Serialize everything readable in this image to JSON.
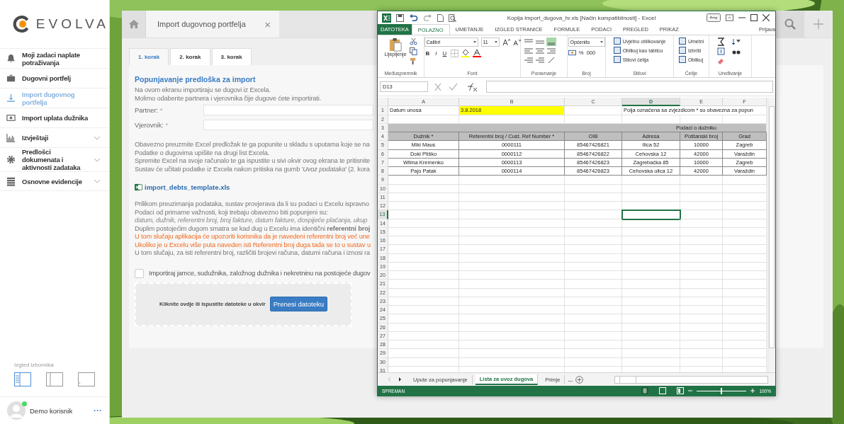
{
  "sidebar": {
    "logo": "EVOLVA",
    "items": [
      {
        "label": "Moji zadaci naplate potraživanja",
        "selected": false,
        "expandable": false
      },
      {
        "label": "Dugovni portfelj",
        "selected": false,
        "expandable": false
      },
      {
        "label": "Import dugovnog portfelja",
        "selected": true,
        "expandable": false
      },
      {
        "label": "Import uplata dužnika",
        "selected": false,
        "expandable": false
      },
      {
        "label": "Izvještaji",
        "selected": false,
        "expandable": true
      },
      {
        "label": "Predlošci dokumenata i aktivnosti zadataka",
        "selected": false,
        "expandable": true
      },
      {
        "label": "Osnovne evidencije",
        "selected": false,
        "expandable": true
      }
    ],
    "layout_label": "Izgled izbornika",
    "layouts": [
      {
        "selected": true
      },
      {
        "selected": false
      },
      {
        "selected": false
      }
    ],
    "user": {
      "name": "Demo korisnik",
      "online": true,
      "menu": "···"
    }
  },
  "tabs": [
    {
      "label": "Import dugovnog portfelja",
      "close": "×",
      "selected": true
    }
  ],
  "steps": [
    {
      "label": "1. korak",
      "selected": true
    },
    {
      "label": "2. korak",
      "selected": false
    },
    {
      "label": "3. korak",
      "selected": false
    }
  ],
  "form": {
    "title": "Popunjavanje predloška za import",
    "intro": [
      {
        "kind": "normal",
        "text": "Na ovom ekranu importiraju se dugovi iz Excela."
      },
      {
        "kind": "normal",
        "text": "Molimo odaberite partnera i vjerovnika čije dugove ćete importirati."
      }
    ],
    "fields": [
      {
        "label": "Partner:",
        "required": "*"
      },
      {
        "label": "Vjerovnik:",
        "required": "*"
      }
    ],
    "instructions": [
      {
        "kind": "normal",
        "text": "Obavezno preuzmite Excel predložak te ga popunite u skladu s uputama koje se na"
      },
      {
        "kind": "normal",
        "text": "Podatke o dugovima upišite na drugi list Excela."
      },
      {
        "kind": "normal",
        "text": "Spremite Excel na svoje računalo te ga ispustite u sivi okvir ovog ekrana te pritisnite"
      },
      {
        "kind": "normal",
        "text": "Sustav će učitati podatke iz Excela nakon pritiska na gumb '*Uvoz podataka*' (2. kora"
      }
    ],
    "template_link": "import_debts_template.xls",
    "checks": [
      {
        "kind": "normal",
        "text": "Prilikom preuzimanja podataka, sustav provjerava da li su podaci u Excelu ispravno"
      },
      {
        "kind": "normal",
        "text": "Podaci od primarne važnosti, koji trebaju obavezno biti popunjeni su:"
      },
      {
        "kind": "italic",
        "text": "datum, dužnik, referentni broj, broj fakture, datum fakture, dospijeće plaćanja, ukup"
      },
      {
        "kind": "normal",
        "text": "Duplim postojećim dugom smatra se kad dug u Excelu ima identični **referentni broj**"
      },
      {
        "kind": "warning",
        "text": "U tom slučaju aplikacija će upozoriti korisnika da je navedeni referentni broj već une"
      },
      {
        "kind": "warning",
        "text": "Ukoliko je u Excelu više puta naveden isti Referentni broj duga tada se to u sustav u"
      },
      {
        "kind": "normal",
        "text": "U tom slučaju, za isti referentni broj, različiti brojevi računa, datumi računa i iznosi ra"
      }
    ],
    "checkbox": {
      "label": "Importiraj jamce, sudužnika, založnog dužnika i nekretninu na postojeće dugov",
      "checked": false
    },
    "dropzone": {
      "hint": "Kliknite ovdje ili ispustite datoteke u okvir",
      "button": "Prenesi datoteku"
    }
  },
  "excel": {
    "title": "Kopija import_dugova_hr.xls  [Način kompatibilnosti] - Excel",
    "ribbon_tabs": [
      {
        "label": "DATOTEKA",
        "kind": "file",
        "selected": false
      },
      {
        "label": "POLAZNO",
        "kind": "tab",
        "selected": true
      },
      {
        "label": "UMETANJE",
        "kind": "tab",
        "selected": false
      },
      {
        "label": "IZGLED STRANICE",
        "kind": "tab",
        "selected": false
      },
      {
        "label": "FORMULE",
        "kind": "tab",
        "selected": false
      },
      {
        "label": "PODACI",
        "kind": "tab",
        "selected": false
      },
      {
        "label": "PREGLED",
        "kind": "tab",
        "selected": false
      },
      {
        "label": "PRIKAZ",
        "kind": "tab",
        "selected": false
      }
    ],
    "account": "Prijava",
    "ribbon": {
      "paste": "Lijepljenje",
      "font": "Calibri",
      "size": "11",
      "bold": "B",
      "italic": "I",
      "underline": "U",
      "number_format": "Općenito",
      "percent": "%",
      "thousands": "000",
      "styles": [
        "Uvjetno oblikovanje",
        "Oblikuj kao tablicu",
        "Stilovi ćelija"
      ],
      "cells": [
        "Umetni",
        "Izbriši",
        "Oblikuj"
      ],
      "groups": [
        "Međuspremnik",
        "Font",
        "Poravnanje",
        "Broj",
        "Stilovi",
        "Ćelije",
        "Uređivanje"
      ]
    },
    "name_box": "D13",
    "columns": [
      {
        "label": "A",
        "selected": false
      },
      {
        "label": "B",
        "selected": false
      },
      {
        "label": "C",
        "selected": false
      },
      {
        "label": "D",
        "selected": true
      },
      {
        "label": "E",
        "selected": false
      },
      {
        "label": "F",
        "selected": false
      }
    ],
    "rows": [
      {
        "number": "1",
        "kind": "data",
        "selected": false,
        "cells": {
          "A": {
            "text": "Datum unosa",
            "highlighted": false
          },
          "B": {
            "text": "3.8.2018",
            "highlighted": true
          },
          "D": {
            "text": "Polja označena sa zvjezdicom * su obavezna za popun",
            "highlighted": false
          }
        }
      },
      {
        "number": "2",
        "kind": "data"
      },
      {
        "number": "3",
        "kind": "group",
        "label": "Podaci o dužniku"
      },
      {
        "number": "4",
        "kind": "header",
        "A": "Dužnik *",
        "B": "Referentni broj / Cust. Ref Number *",
        "C": "OIB",
        "D": "Adresa",
        "E": "Poštanski broj",
        "F": "Grad"
      },
      {
        "number": "5",
        "kind": "record",
        "A": "Miki Maus",
        "B": "0000111",
        "C": "85467426821",
        "D": "Ilica 52",
        "E": "10000",
        "F": "Zagreb"
      },
      {
        "number": "6",
        "kind": "record",
        "A": "Doki Pliško",
        "B": "0000112",
        "C": "85467426822",
        "D": "Cehovska 12",
        "E": "42000",
        "F": "Varaždin"
      },
      {
        "number": "7",
        "kind": "record",
        "A": "Wilma Kremenko",
        "B": "0000113",
        "C": "85467426823",
        "D": "Zagrebačka 85",
        "E": "10000",
        "F": "Zagreb"
      },
      {
        "number": "8",
        "kind": "record",
        "A": "Pajo Patak",
        "B": "0000114",
        "C": "85467426823",
        "D": "Cehovska ulica 12",
        "E": "42000",
        "F": "Varaždin"
      },
      {
        "number": "9",
        "kind": "data"
      },
      {
        "number": "10",
        "kind": "data"
      },
      {
        "number": "11",
        "kind": "data"
      },
      {
        "number": "12",
        "kind": "data"
      },
      {
        "number": "13",
        "kind": "data",
        "selected": true
      },
      {
        "number": "14",
        "kind": "data"
      },
      {
        "number": "15",
        "kind": "data"
      },
      {
        "number": "16",
        "kind": "data"
      },
      {
        "number": "17",
        "kind": "data"
      },
      {
        "number": "18",
        "kind": "data"
      },
      {
        "number": "19",
        "kind": "data"
      },
      {
        "number": "20",
        "kind": "data"
      },
      {
        "number": "21",
        "kind": "data"
      },
      {
        "number": "22",
        "kind": "data"
      },
      {
        "number": "23",
        "kind": "data"
      },
      {
        "number": "24",
        "kind": "data"
      },
      {
        "number": "25",
        "kind": "data"
      },
      {
        "number": "26",
        "kind": "data"
      },
      {
        "number": "27",
        "kind": "data"
      },
      {
        "number": "28",
        "kind": "data"
      },
      {
        "number": "29",
        "kind": "data"
      },
      {
        "number": "30",
        "kind": "data"
      },
      {
        "number": "31",
        "kind": "data"
      }
    ],
    "sheets": [
      {
        "label": "Upute za popunjavanje",
        "selected": false
      },
      {
        "label": "Lista za uvoz dugova",
        "selected": true
      },
      {
        "label": "Primje",
        "selected": false
      }
    ],
    "more_sheets": "...",
    "status": "SPREMAN",
    "zoom": "100%",
    "zoom_slider": {
      "level": 0.5
    }
  }
}
